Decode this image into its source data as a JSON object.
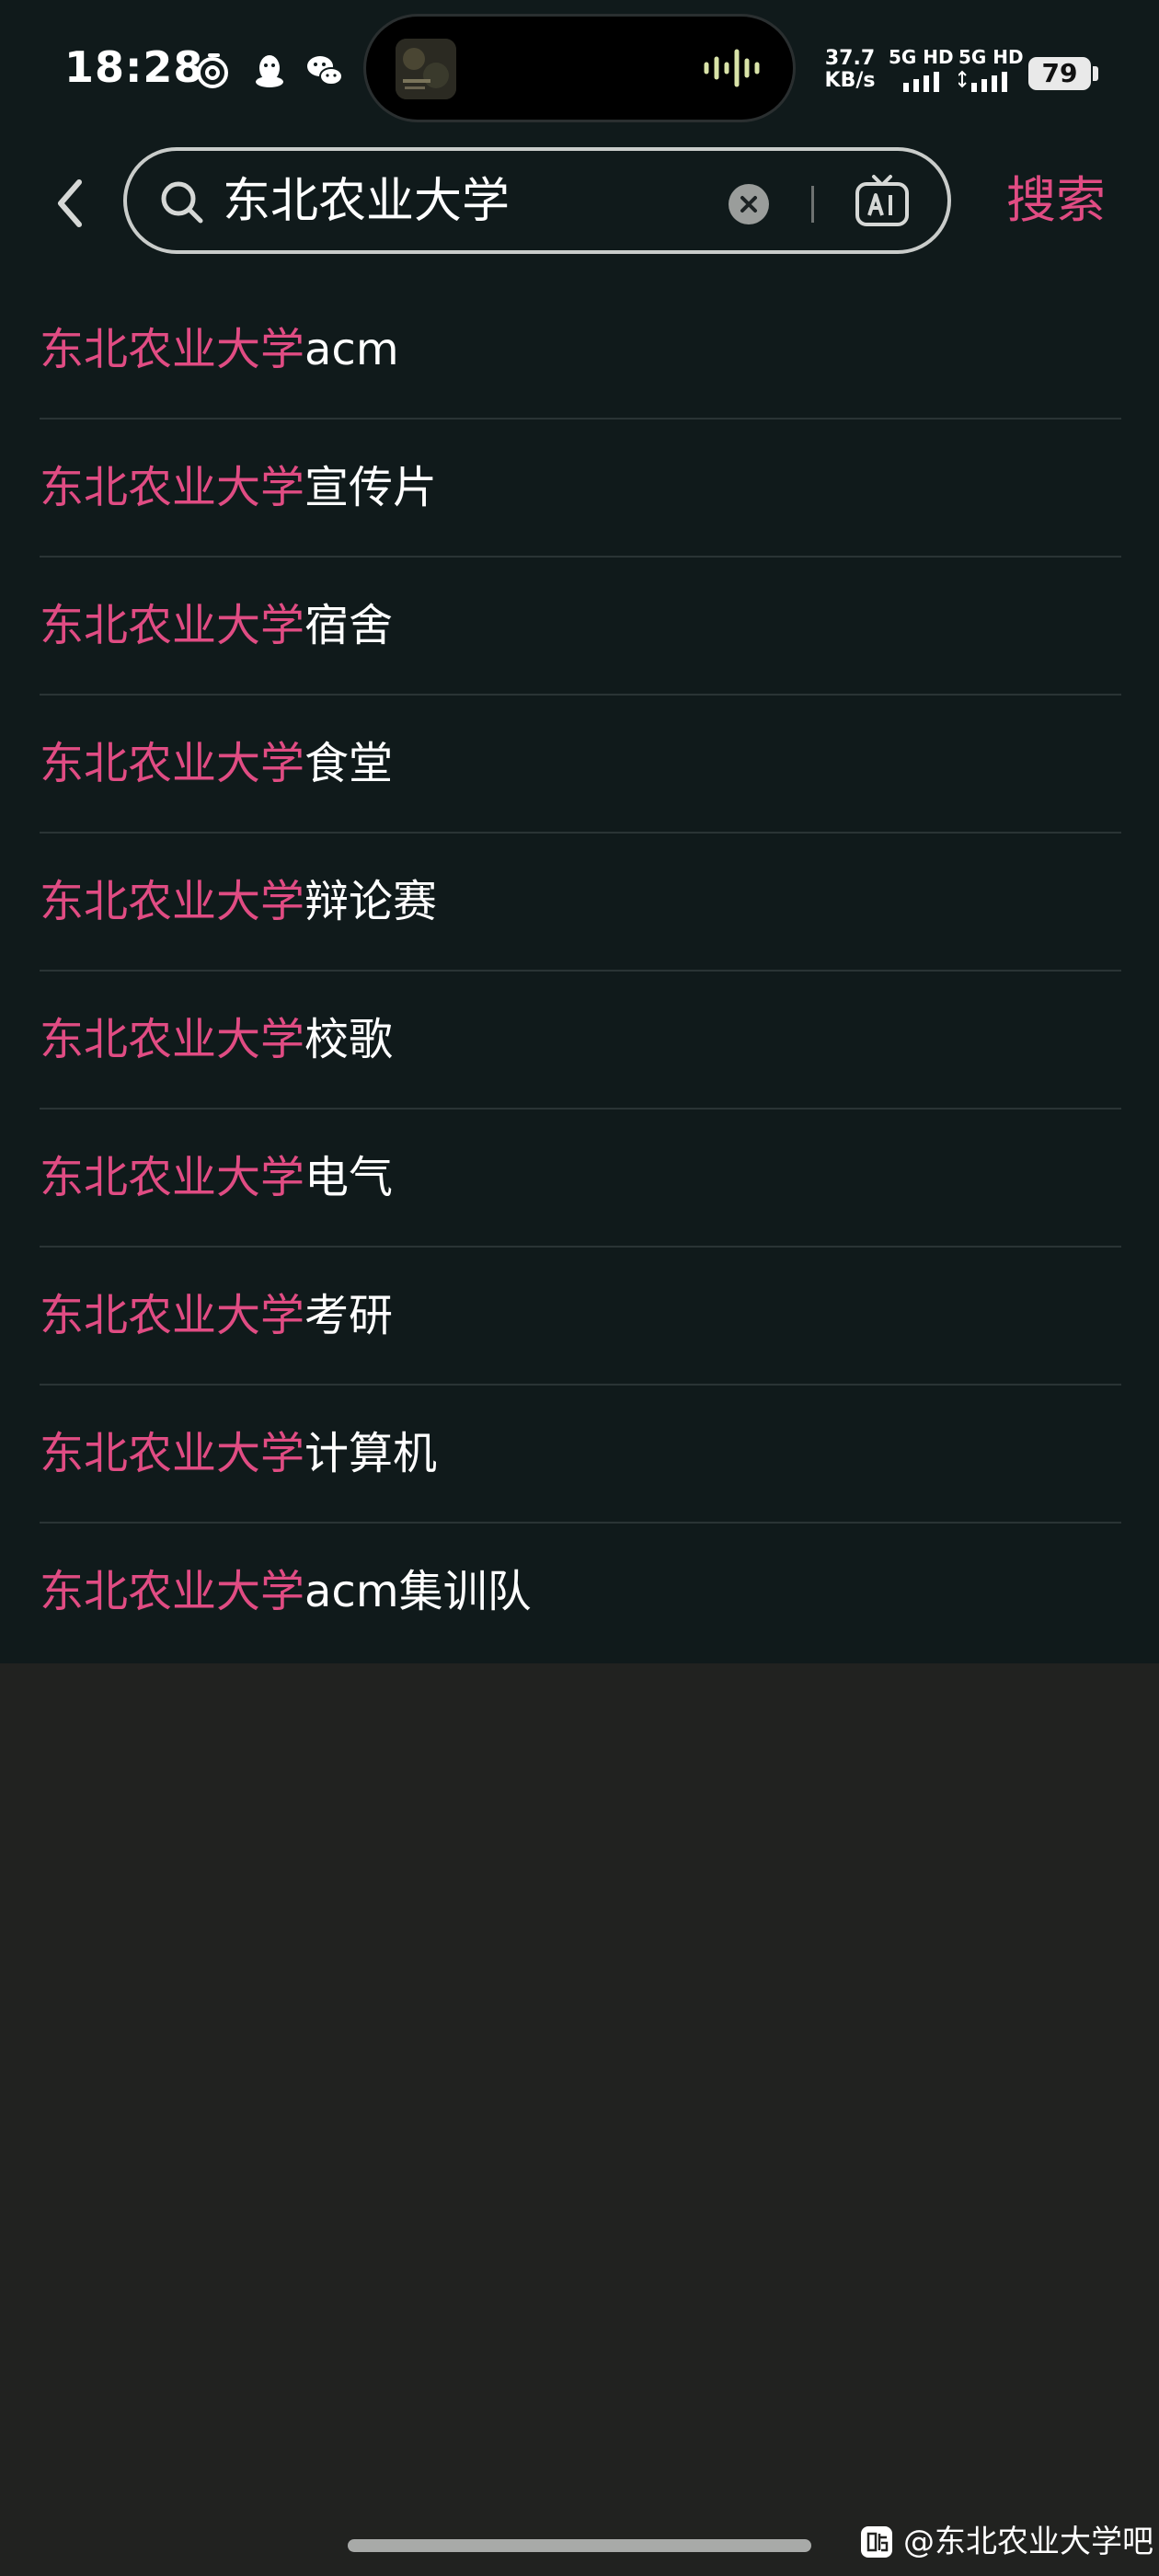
{
  "status_bar": {
    "time": "18:28",
    "net_speed_value": "37.7",
    "net_speed_unit": "KB/s",
    "signal1_label": "5G HD",
    "signal2_label": "5G HD",
    "battery": "79",
    "icons": [
      "netease-music-icon",
      "qq-icon",
      "wechat-icon"
    ]
  },
  "search": {
    "query": "东北农业大学",
    "search_label": "搜索"
  },
  "suggestions": [
    {
      "highlight": "东北农业大学",
      "rest": "acm"
    },
    {
      "highlight": "东北农业大学",
      "rest": "宣传片"
    },
    {
      "highlight": "东北农业大学",
      "rest": "宿舍"
    },
    {
      "highlight": "东北农业大学",
      "rest": "食堂"
    },
    {
      "highlight": "东北农业大学",
      "rest": "辩论赛"
    },
    {
      "highlight": "东北农业大学",
      "rest": "校歌"
    },
    {
      "highlight": "东北农业大学",
      "rest": "电气"
    },
    {
      "highlight": "东北农业大学",
      "rest": "考研"
    },
    {
      "highlight": "东北农业大学",
      "rest": "计算机"
    },
    {
      "highlight": "东北农业大学",
      "rest": "acm集训队"
    }
  ],
  "watermark": {
    "text": "@东北农业大学吧"
  },
  "colors": {
    "accent": "#e04c83",
    "list_background": "#101a1b",
    "page_background": "#212220"
  }
}
